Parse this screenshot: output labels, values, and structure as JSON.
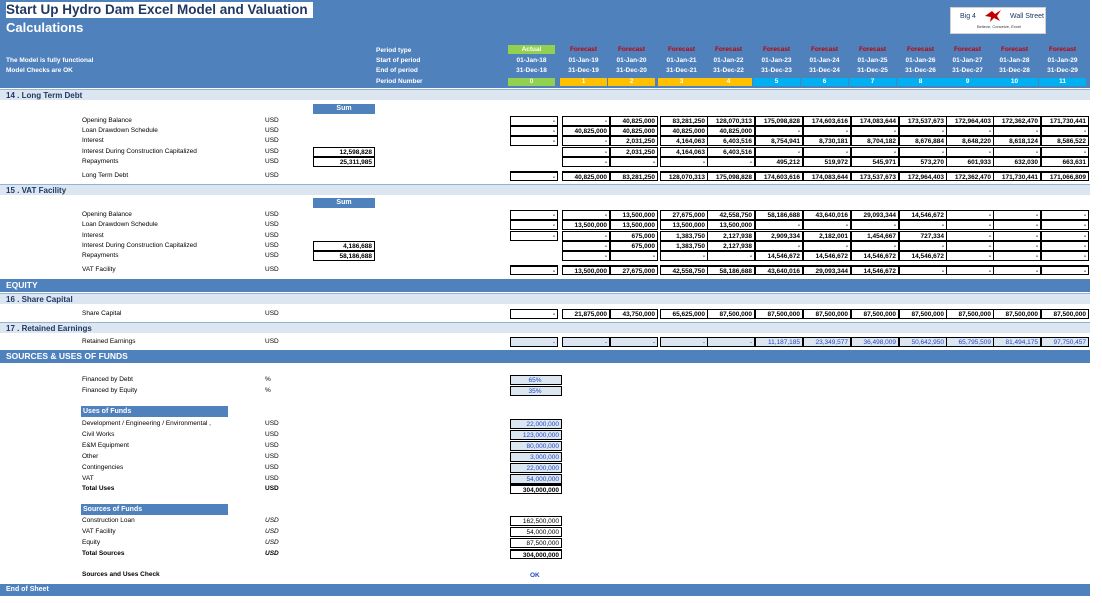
{
  "title": "Start Up Hydro Dam Excel Model and Valuation",
  "subtitle": "Calculations",
  "logo": {
    "left": "Big 4",
    "right": "Wall Street",
    "tagline": "Believe, Conceive, Excel"
  },
  "status": {
    "line1": "The Model is fully functional",
    "line2": "Model Checks are OK"
  },
  "period_labels": [
    "Period type",
    "Start of period",
    "End of period",
    "Period Number"
  ],
  "periods": [
    {
      "type": "Actual",
      "start": "01-Jan-18",
      "end": "31-Dec-18",
      "num": "0",
      "color": "#92d050"
    },
    {
      "type": "Forecast",
      "start": "01-Jan-19",
      "end": "31-Dec-19",
      "num": "1",
      "color": "#ffc000"
    },
    {
      "type": "Forecast",
      "start": "01-Jan-20",
      "end": "31-Dec-20",
      "num": "2",
      "color": "#ffc000"
    },
    {
      "type": "Forecast",
      "start": "01-Jan-21",
      "end": "31-Dec-21",
      "num": "3",
      "color": "#ffc000"
    },
    {
      "type": "Forecast",
      "start": "01-Jan-22",
      "end": "31-Dec-22",
      "num": "4",
      "color": "#ffc000"
    },
    {
      "type": "Forecast",
      "start": "01-Jan-23",
      "end": "31-Dec-23",
      "num": "5",
      "color": "#00b0f0"
    },
    {
      "type": "Forecast",
      "start": "01-Jan-24",
      "end": "31-Dec-24",
      "num": "6",
      "color": "#00b0f0"
    },
    {
      "type": "Forecast",
      "start": "01-Jan-25",
      "end": "31-Dec-25",
      "num": "7",
      "color": "#00b0f0"
    },
    {
      "type": "Forecast",
      "start": "01-Jan-26",
      "end": "31-Dec-26",
      "num": "8",
      "color": "#00b0f0"
    },
    {
      "type": "Forecast",
      "start": "01-Jan-27",
      "end": "31-Dec-27",
      "num": "9",
      "color": "#00b0f0"
    },
    {
      "type": "Forecast",
      "start": "01-Jan-28",
      "end": "31-Dec-28",
      "num": "10",
      "color": "#00b0f0"
    },
    {
      "type": "Forecast",
      "start": "01-Jan-29",
      "end": "31-Dec-29",
      "num": "11",
      "color": "#00b0f0"
    }
  ],
  "sections": {
    "ltd": {
      "title": "14 . Long Term Debt",
      "sum_label": "Sum",
      "rows": [
        {
          "label": "Opening Balance",
          "unit": "USD",
          "sum": "",
          "vals": [
            "-",
            "-",
            "40,825,000",
            "83,281,250",
            "128,070,313",
            "175,098,828",
            "174,603,616",
            "174,083,644",
            "173,537,673",
            "172,964,403",
            "172,362,470",
            "171,730,441"
          ]
        },
        {
          "label": "Loan Drawdown Schedule",
          "unit": "USD",
          "sum": "",
          "vals": [
            "-",
            "40,825,000",
            "40,825,000",
            "40,825,000",
            "40,825,000",
            "-",
            "-",
            "-",
            "-",
            "-",
            "-",
            "-"
          ]
        },
        {
          "label": "Interest",
          "unit": "USD",
          "sum": "",
          "vals": [
            "-",
            "-",
            "2,031,250",
            "4,164,063",
            "6,403,516",
            "8,754,941",
            "8,730,181",
            "8,704,182",
            "8,676,884",
            "8,648,220",
            "8,618,124",
            "8,586,522"
          ]
        },
        {
          "label": "Interest During Construction Capitalized",
          "unit": "USD",
          "sum": "12,598,828",
          "vals": [
            "",
            "-",
            "2,031,250",
            "4,164,063",
            "6,403,516",
            "-",
            "-",
            "-",
            "-",
            "-",
            "-",
            "-"
          ]
        },
        {
          "label": "Repayments",
          "unit": "USD",
          "sum": "25,311,985",
          "vals": [
            "",
            "-",
            "-",
            "-",
            "-",
            "495,212",
            "519,972",
            "545,971",
            "573,270",
            "601,933",
            "632,030",
            "663,631"
          ]
        }
      ],
      "total": {
        "label": "Long Term Debt",
        "unit": "USD",
        "vals": [
          "-",
          "40,825,000",
          "83,281,250",
          "128,070,313",
          "175,098,828",
          "174,603,616",
          "174,083,644",
          "173,537,673",
          "172,964,403",
          "172,362,470",
          "171,730,441",
          "171,066,809"
        ]
      }
    },
    "vat": {
      "title": "15 . VAT Facility",
      "sum_label": "Sum",
      "rows": [
        {
          "label": "Opening Balance",
          "unit": "USD",
          "sum": "",
          "vals": [
            "-",
            "-",
            "13,500,000",
            "27,675,000",
            "42,558,750",
            "58,186,688",
            "43,640,016",
            "29,093,344",
            "14,546,672",
            "-",
            "-",
            "-"
          ]
        },
        {
          "label": "Loan Drawdown Schedule",
          "unit": "USD",
          "sum": "",
          "vals": [
            "-",
            "13,500,000",
            "13,500,000",
            "13,500,000",
            "13,500,000",
            "-",
            "-",
            "-",
            "-",
            "-",
            "-",
            "-"
          ]
        },
        {
          "label": "Interest",
          "unit": "USD",
          "sum": "",
          "vals": [
            "-",
            "-",
            "675,000",
            "1,383,750",
            "2,127,938",
            "2,909,334",
            "2,182,001",
            "1,454,667",
            "727,334",
            "-",
            "-",
            "-"
          ]
        },
        {
          "label": "Interest During Construction Capitalized",
          "unit": "USD",
          "sum": "4,186,688",
          "vals": [
            "",
            "-",
            "675,000",
            "1,383,750",
            "2,127,938",
            "-",
            "-",
            "-",
            "-",
            "-",
            "-",
            "-"
          ]
        },
        {
          "label": "Repayments",
          "unit": "USD",
          "sum": "58,186,688",
          "vals": [
            "",
            "-",
            "-",
            "-",
            "-",
            "14,546,672",
            "14,546,672",
            "14,546,672",
            "14,546,672",
            "-",
            "-",
            "-"
          ]
        }
      ],
      "total": {
        "label": "VAT Facility",
        "unit": "USD",
        "vals": [
          "-",
          "13,500,000",
          "27,675,000",
          "42,558,750",
          "58,186,688",
          "43,640,016",
          "29,093,344",
          "14,546,672",
          "-",
          "-",
          "-",
          "-"
        ]
      }
    },
    "equity_header": "EQUITY",
    "share": {
      "title": "16 . Share Capital",
      "row": {
        "label": "Share Capital",
        "unit": "USD",
        "vals": [
          "-",
          "21,875,000",
          "43,750,000",
          "65,625,000",
          "87,500,000",
          "87,500,000",
          "87,500,000",
          "87,500,000",
          "87,500,000",
          "87,500,000",
          "87,500,000",
          "87,500,000"
        ]
      }
    },
    "retained": {
      "title": "17 . Retained Earnings",
      "row": {
        "label": "Retained Earnings",
        "unit": "USD",
        "vals": [
          "-",
          "-",
          "-",
          "-",
          "-",
          "11,187,185",
          "23,349,577",
          "36,498,009",
          "50,642,950",
          "65,795,509",
          "81,494,175",
          "97,750,457"
        ]
      }
    },
    "sources_header": "SOURCES & USES OF FUNDS",
    "financing": [
      {
        "label": "Financed by Debt",
        "unit": "%",
        "val": "65%"
      },
      {
        "label": "Financed by Equity",
        "unit": "%",
        "val": "35%"
      }
    ],
    "uses_title": "Uses of Funds",
    "uses": [
      {
        "label": "Development / Engineering / Environmental ,",
        "unit": "USD",
        "val": "22,000,000"
      },
      {
        "label": "Civil Works",
        "unit": "USD",
        "val": "123,000,000"
      },
      {
        "label": "E&M Equipment",
        "unit": "USD",
        "val": "80,000,000"
      },
      {
        "label": "Other",
        "unit": "USD",
        "val": "3,000,000"
      },
      {
        "label": "Contingencies",
        "unit": "USD",
        "val": "22,000,000"
      },
      {
        "label": "VAT",
        "unit": "USD",
        "val": "54,000,000"
      }
    ],
    "uses_total": {
      "label": "Total Uses",
      "unit": "USD",
      "val": "304,000,000"
    },
    "sources_title": "Sources of Funds",
    "sources": [
      {
        "label": "Construction Loan",
        "unit": "USD",
        "val": "162,500,000"
      },
      {
        "label": "VAT Facility",
        "unit": "USD",
        "val": "54,000,000"
      },
      {
        "label": "Equity",
        "unit": "USD",
        "val": "87,500,000"
      }
    ],
    "sources_total": {
      "label": "Total Sources",
      "unit": "USD",
      "val": "304,000,000"
    },
    "check": {
      "label": "Sources and Uses Check",
      "val": "OK"
    },
    "end": "End of Sheet"
  }
}
